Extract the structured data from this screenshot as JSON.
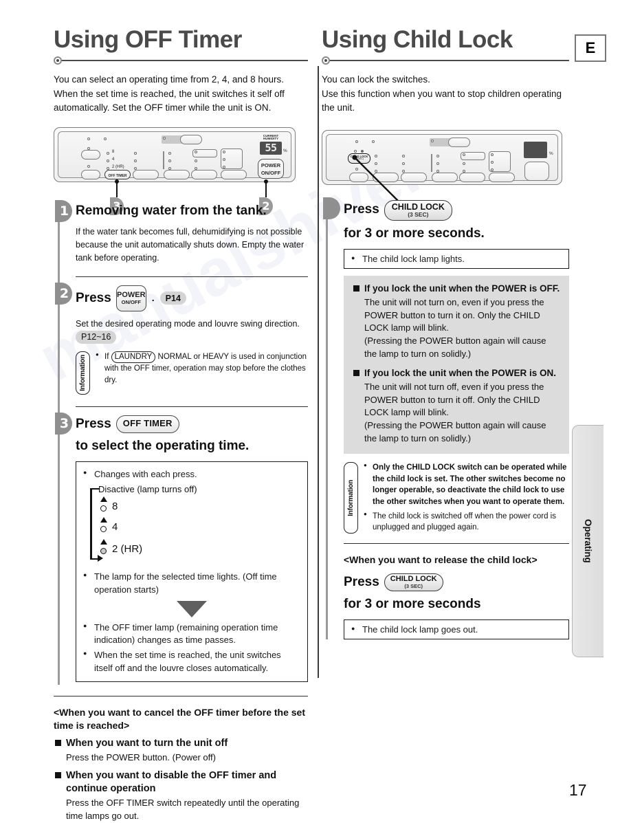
{
  "language_badge": "E",
  "page_number": "17",
  "side_tab": "Operating",
  "left": {
    "title": "Using OFF Timer",
    "intro": "You can select an operating time from 2, 4, and 8 hours. When the set time is reached, the unit switches it self off automatically. Set the OFF timer while the unit is ON.",
    "panel": {
      "humidity_label": "CURRENT\nHUMIDITY",
      "humidity_value": "55",
      "humidity_unit": "%",
      "power_label": "POWER",
      "power_sublabel": "ON/OFF",
      "off_timer_label": "OFF TIMER",
      "lamp_8": "8",
      "lamp_4": "4",
      "lamp_2": "2 (HR)",
      "callout_off_timer": "3",
      "callout_power": "2"
    },
    "steps": [
      {
        "number": "1",
        "heading": "Removing water from the tank.",
        "body": "If the water tank becomes full, dehumidifying is not possible because the unit automatically shuts down. Empty the water tank before operating."
      },
      {
        "number": "2",
        "heading_press": "Press",
        "key_line1": "POWER",
        "key_line2": "ON/OFF",
        "separator": ".",
        "page_ref": "P14",
        "body": "Set the desired operating mode and louvre swing direction.",
        "body_page_ref": "P12~16",
        "info_tab": "Information",
        "info_items_pre": "If",
        "info_boxref": "LAUNDRY",
        "info_items_post": "NORMAL or HEAVY is used in conjunction with the OFF timer, operation may stop before the clothes dry."
      },
      {
        "number": "3",
        "heading_press": "Press",
        "key": "OFF TIMER",
        "heading_rest": "to select the operating time.",
        "note_items": [
          "Changes with each press.",
          "The lamp for the selected time lights. (Off time operation starts)",
          "The OFF timer lamp (remaining operation time indication) changes as time passes.",
          "When the set time is reached, the unit switches itself off and the louvre closes automatically."
        ],
        "cycle": {
          "disactive": "Disactive (lamp turns off)",
          "values": [
            "8",
            "4",
            "2 (HR)"
          ]
        }
      }
    ],
    "cancel_section": {
      "title": "<When you want to cancel the OFF timer before the set time is reached>",
      "items": [
        {
          "head": "When you want to turn the unit off",
          "body": "Press the POWER button. (Power off)"
        },
        {
          "head": "When you want to disable the OFF timer and continue operation",
          "body": "Press the OFF TIMER switch repeatedly until the operating time lamps go out."
        }
      ]
    }
  },
  "right": {
    "title": "Using Child Lock",
    "intro": "You can lock the switches.\nUse this function when you want to stop children operating the unit.",
    "panel": {
      "child_lock_label": "CHILD LOCK",
      "child_lock_sublabel": "(3 SEC)",
      "humidity_unit": "%"
    },
    "step": {
      "press": "Press",
      "key_line1": "CHILD LOCK",
      "key_line2": "(3 SEC)",
      "rest": "for 3 or more seconds.",
      "lamp_note": "The child lock lamp lights."
    },
    "grey_items": [
      {
        "head": "If you lock the unit when the POWER is OFF.",
        "body": "The unit will not turn on, even if you press the POWER button to turn it on. Only the CHILD LOCK lamp will blink.\n(Pressing the POWER button again will cause the lamp to turn on solidly.)"
      },
      {
        "head": "If you lock the unit when the POWER is ON.",
        "body": "The unit will not turn off, even if you press the POWER button to turn it off. Only the CHILD LOCK lamp will blink.\n(Pressing the POWER button again will cause the lamp to turn on solidly.)"
      }
    ],
    "info": {
      "tab": "Information",
      "items": [
        "Only the CHILD LOCK switch can be operated while the child lock is set. The other switches become no longer operable, so deactivate the child lock to use the other switches when you want to operate them.",
        "The child lock is switched off when the power cord is unplugged and plugged again."
      ]
    },
    "release_section": {
      "title": "<When you want to release the child lock>",
      "press": "Press",
      "key_line1": "CHILD LOCK",
      "key_line2": "(3 SEC)",
      "rest": "for 3 or more seconds",
      "lamp_note": "The child lock lamp goes out."
    }
  },
  "watermark": "manualshive.com"
}
